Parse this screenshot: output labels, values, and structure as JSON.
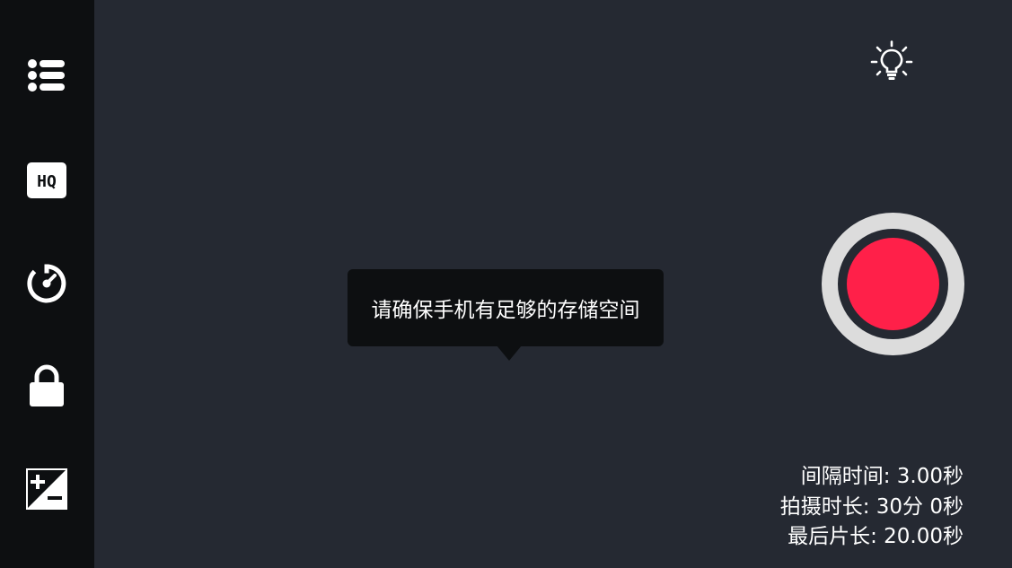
{
  "sidebar": {
    "items": [
      {
        "icon": "list-icon"
      },
      {
        "icon": "hq-icon",
        "label": "HQ"
      },
      {
        "icon": "timer-icon"
      },
      {
        "icon": "lock-icon"
      },
      {
        "icon": "exposure-icon"
      }
    ]
  },
  "top_right": {
    "icon": "lightbulb-icon"
  },
  "record_button": {
    "icon": "record-icon",
    "colors": {
      "ring": "#dcdcdc",
      "dot": "#ff2049"
    }
  },
  "tooltip": {
    "text": "请确保手机有足够的存储空间"
  },
  "info": {
    "interval": "间隔时间: 3.00秒",
    "duration": "拍摄时长: 30分 0秒",
    "final_length": "最后片长: 20.00秒"
  },
  "colors": {
    "background": "#252932",
    "sidebar": "#0d0f11",
    "accent": "#ff2049",
    "text": "#ffffff"
  }
}
